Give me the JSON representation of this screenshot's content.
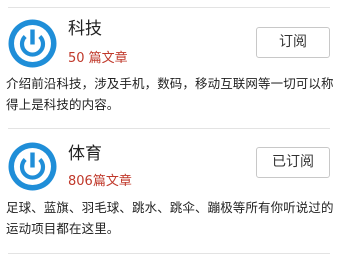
{
  "categories": [
    {
      "title": "科技",
      "count": "50 篇文章",
      "button_label": "订阅",
      "description": "介绍前沿科技，涉及手机，数码，移动互联网等一切可以称得上是科技的内容。",
      "icon": "power-icon"
    },
    {
      "title": "体育",
      "count": "806篇文章",
      "button_label": "已订阅",
      "description": "足球、蓝旗、羽毛球、跳水、跳伞、蹦极等所有你听说过的运动项目都在这里。",
      "icon": "power-icon"
    }
  ],
  "colors": {
    "logo_blue": "#1f8ed8",
    "count_red": "#c0392b",
    "divider": "#e3e3e3"
  }
}
